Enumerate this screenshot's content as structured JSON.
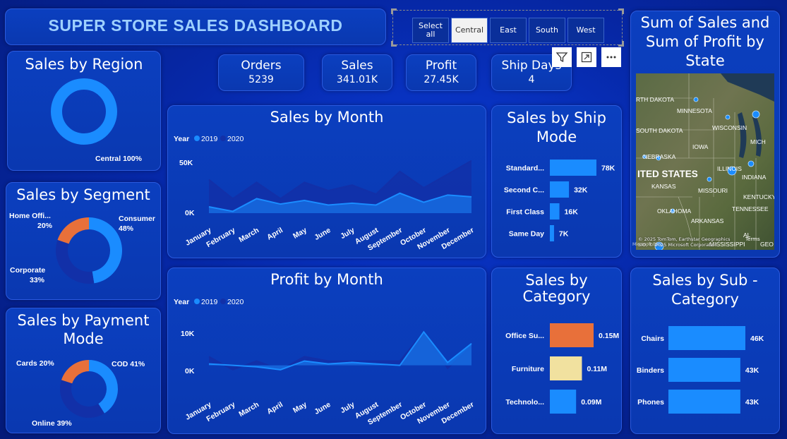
{
  "title": "SUPER STORE SALES DASHBOARD",
  "slicer": {
    "items": [
      {
        "label_line1": "Select",
        "label_line2": "all"
      },
      {
        "label": "Central"
      },
      {
        "label": "East"
      },
      {
        "label": "South"
      },
      {
        "label": "West"
      }
    ],
    "selected": "Central"
  },
  "kpis": [
    {
      "label": "Orders",
      "value": "5239"
    },
    {
      "label": "Sales",
      "value": "341.01K"
    },
    {
      "label": "Profit",
      "value": "27.45K"
    },
    {
      "label": "Ship Days",
      "value": "4"
    }
  ],
  "toolbar": {
    "filter_icon": "filter-icon",
    "focus_icon": "expand-icon",
    "more_icon": "more-options-icon"
  },
  "region": {
    "title": "Sales by Region",
    "label": "Central 100%"
  },
  "segment": {
    "title": "Sales by Segment",
    "labels": {
      "home_name": "Home Offi...",
      "home_pct": "20%",
      "consumer_name": "Consumer",
      "consumer_pct": "48%",
      "corporate_name": "Corporate",
      "corporate_pct": "33%"
    }
  },
  "payment": {
    "title_line1": "Sales by Payment",
    "title_line2": "Mode",
    "labels": {
      "cards": "Cards 20%",
      "cod": "COD 41%",
      "online": "Online 39%"
    }
  },
  "sales_month": {
    "title": "Sales by Month",
    "legend_year": "Year",
    "legend_2019": "2019",
    "legend_2020": "2020",
    "y_ticks": [
      "50K",
      "0K"
    ]
  },
  "profit_month": {
    "title": "Profit by Month",
    "legend_year": "Year",
    "legend_2019": "2019",
    "legend_2020": "2020",
    "y_ticks": [
      "10K",
      "0K"
    ]
  },
  "ship_mode": {
    "title_line1": "Sales by Ship",
    "title_line2": "Mode"
  },
  "category": {
    "title_line1": "Sales by",
    "title_line2": "Category"
  },
  "subcategory": {
    "title_line1": "Sales by Sub -",
    "title_line2": "Category"
  },
  "map": {
    "title_line1": "Sum of Sales and",
    "title_line2": "Sum of Profit by",
    "title_line3": "State",
    "labels": {
      "nd": "RTH DAKOTA",
      "mn": "MINNESOTA",
      "wi": "WISCONSIN",
      "mi": "MICH",
      "sd": "SOUTH DAKOTA",
      "ia": "IOWA",
      "ne": "NEBRASKA",
      "us": "ITED STATES",
      "il": "ILLINOIS",
      "ind": "INDIANA",
      "ks": "KANSAS",
      "mo": "MISSOURI",
      "ky": "KENTUCKY",
      "ok": "OKLAHOMA",
      "tn": "TENNESSEE",
      "ar": "ARKANSAS",
      "ms": "MISSISSIPPI",
      "al": "AL",
      "ge": "GEO"
    },
    "attribution_line1": "© 2025 TomTom, Earthstar Geographics",
    "attribution_line2": "SIO, © 2025 Microsoft Corporation",
    "terms": "Terms",
    "brand": "Microsoft Bing"
  },
  "chart_data": [
    {
      "type": "pie",
      "title": "Sales by Region",
      "labels": [
        "Central"
      ],
      "values": [
        100
      ],
      "colors": [
        "#1a8cff"
      ]
    },
    {
      "type": "pie",
      "title": "Sales by Segment",
      "labels": [
        "Consumer",
        "Corporate",
        "Home Offi..."
      ],
      "values": [
        48,
        33,
        20
      ],
      "colors": [
        "#1a8cff",
        "#1230a8",
        "#e8703a"
      ]
    },
    {
      "type": "pie",
      "title": "Sales by Payment Mode",
      "labels": [
        "COD",
        "Online",
        "Cards"
      ],
      "values": [
        41,
        39,
        20
      ],
      "colors": [
        "#1a8cff",
        "#1230a8",
        "#e8703a"
      ]
    },
    {
      "type": "area",
      "title": "Sales by Month",
      "categories": [
        "January",
        "February",
        "March",
        "April",
        "May",
        "June",
        "July",
        "August",
        "September",
        "October",
        "November",
        "December"
      ],
      "ylim": [
        0,
        60000
      ],
      "series": [
        {
          "name": "2019",
          "color": "#1a8cff",
          "values": [
            7000,
            2000,
            16000,
            10000,
            14000,
            9000,
            11000,
            9000,
            22000,
            12000,
            20000,
            18000
          ]
        },
        {
          "name": "2020",
          "color": "#1230a8",
          "values": [
            37000,
            16000,
            34000,
            16000,
            34000,
            25000,
            31000,
            21000,
            46000,
            28000,
            43000,
            58000
          ]
        }
      ]
    },
    {
      "type": "area",
      "title": "Profit by Month",
      "categories": [
        "January",
        "February",
        "March",
        "April",
        "May",
        "June",
        "July",
        "August",
        "September",
        "October",
        "November",
        "December"
      ],
      "ylim": [
        -3000,
        14000
      ],
      "series": [
        {
          "name": "2019",
          "color": "#1a8cff",
          "values": [
            500,
            0,
            -500,
            -1500,
            1500,
            500,
            1000,
            500,
            0,
            11500,
            1000,
            7500
          ]
        },
        {
          "name": "2020",
          "color": "#1230a8",
          "values": [
            3000,
            -1500,
            1500,
            -1500,
            3000,
            1500,
            1500,
            1500,
            1500,
            11500,
            -1000,
            6500
          ]
        }
      ]
    },
    {
      "type": "bar",
      "title": "Sales by Ship Mode",
      "categories": [
        "Standard...",
        "Second C...",
        "First Class",
        "Same Day"
      ],
      "values": [
        78,
        32,
        16,
        7
      ],
      "labels": [
        "78K",
        "32K",
        "16K",
        "7K"
      ],
      "color": "#1a8cff"
    },
    {
      "type": "bar",
      "title": "Sales by Category",
      "categories": [
        "Office Su...",
        "Furniture",
        "Technolo..."
      ],
      "values": [
        0.15,
        0.11,
        0.09
      ],
      "labels": [
        "0.15M",
        "0.11M",
        "0.09M"
      ],
      "colors": [
        "#e8703a",
        "#f1e19f",
        "#1a8cff"
      ]
    },
    {
      "type": "bar",
      "title": "Sales by Sub - Category",
      "categories": [
        "Chairs",
        "Binders",
        "Phones"
      ],
      "values": [
        46,
        43,
        43
      ],
      "labels": [
        "46K",
        "43K",
        "43K"
      ],
      "color": "#1a8cff"
    }
  ]
}
